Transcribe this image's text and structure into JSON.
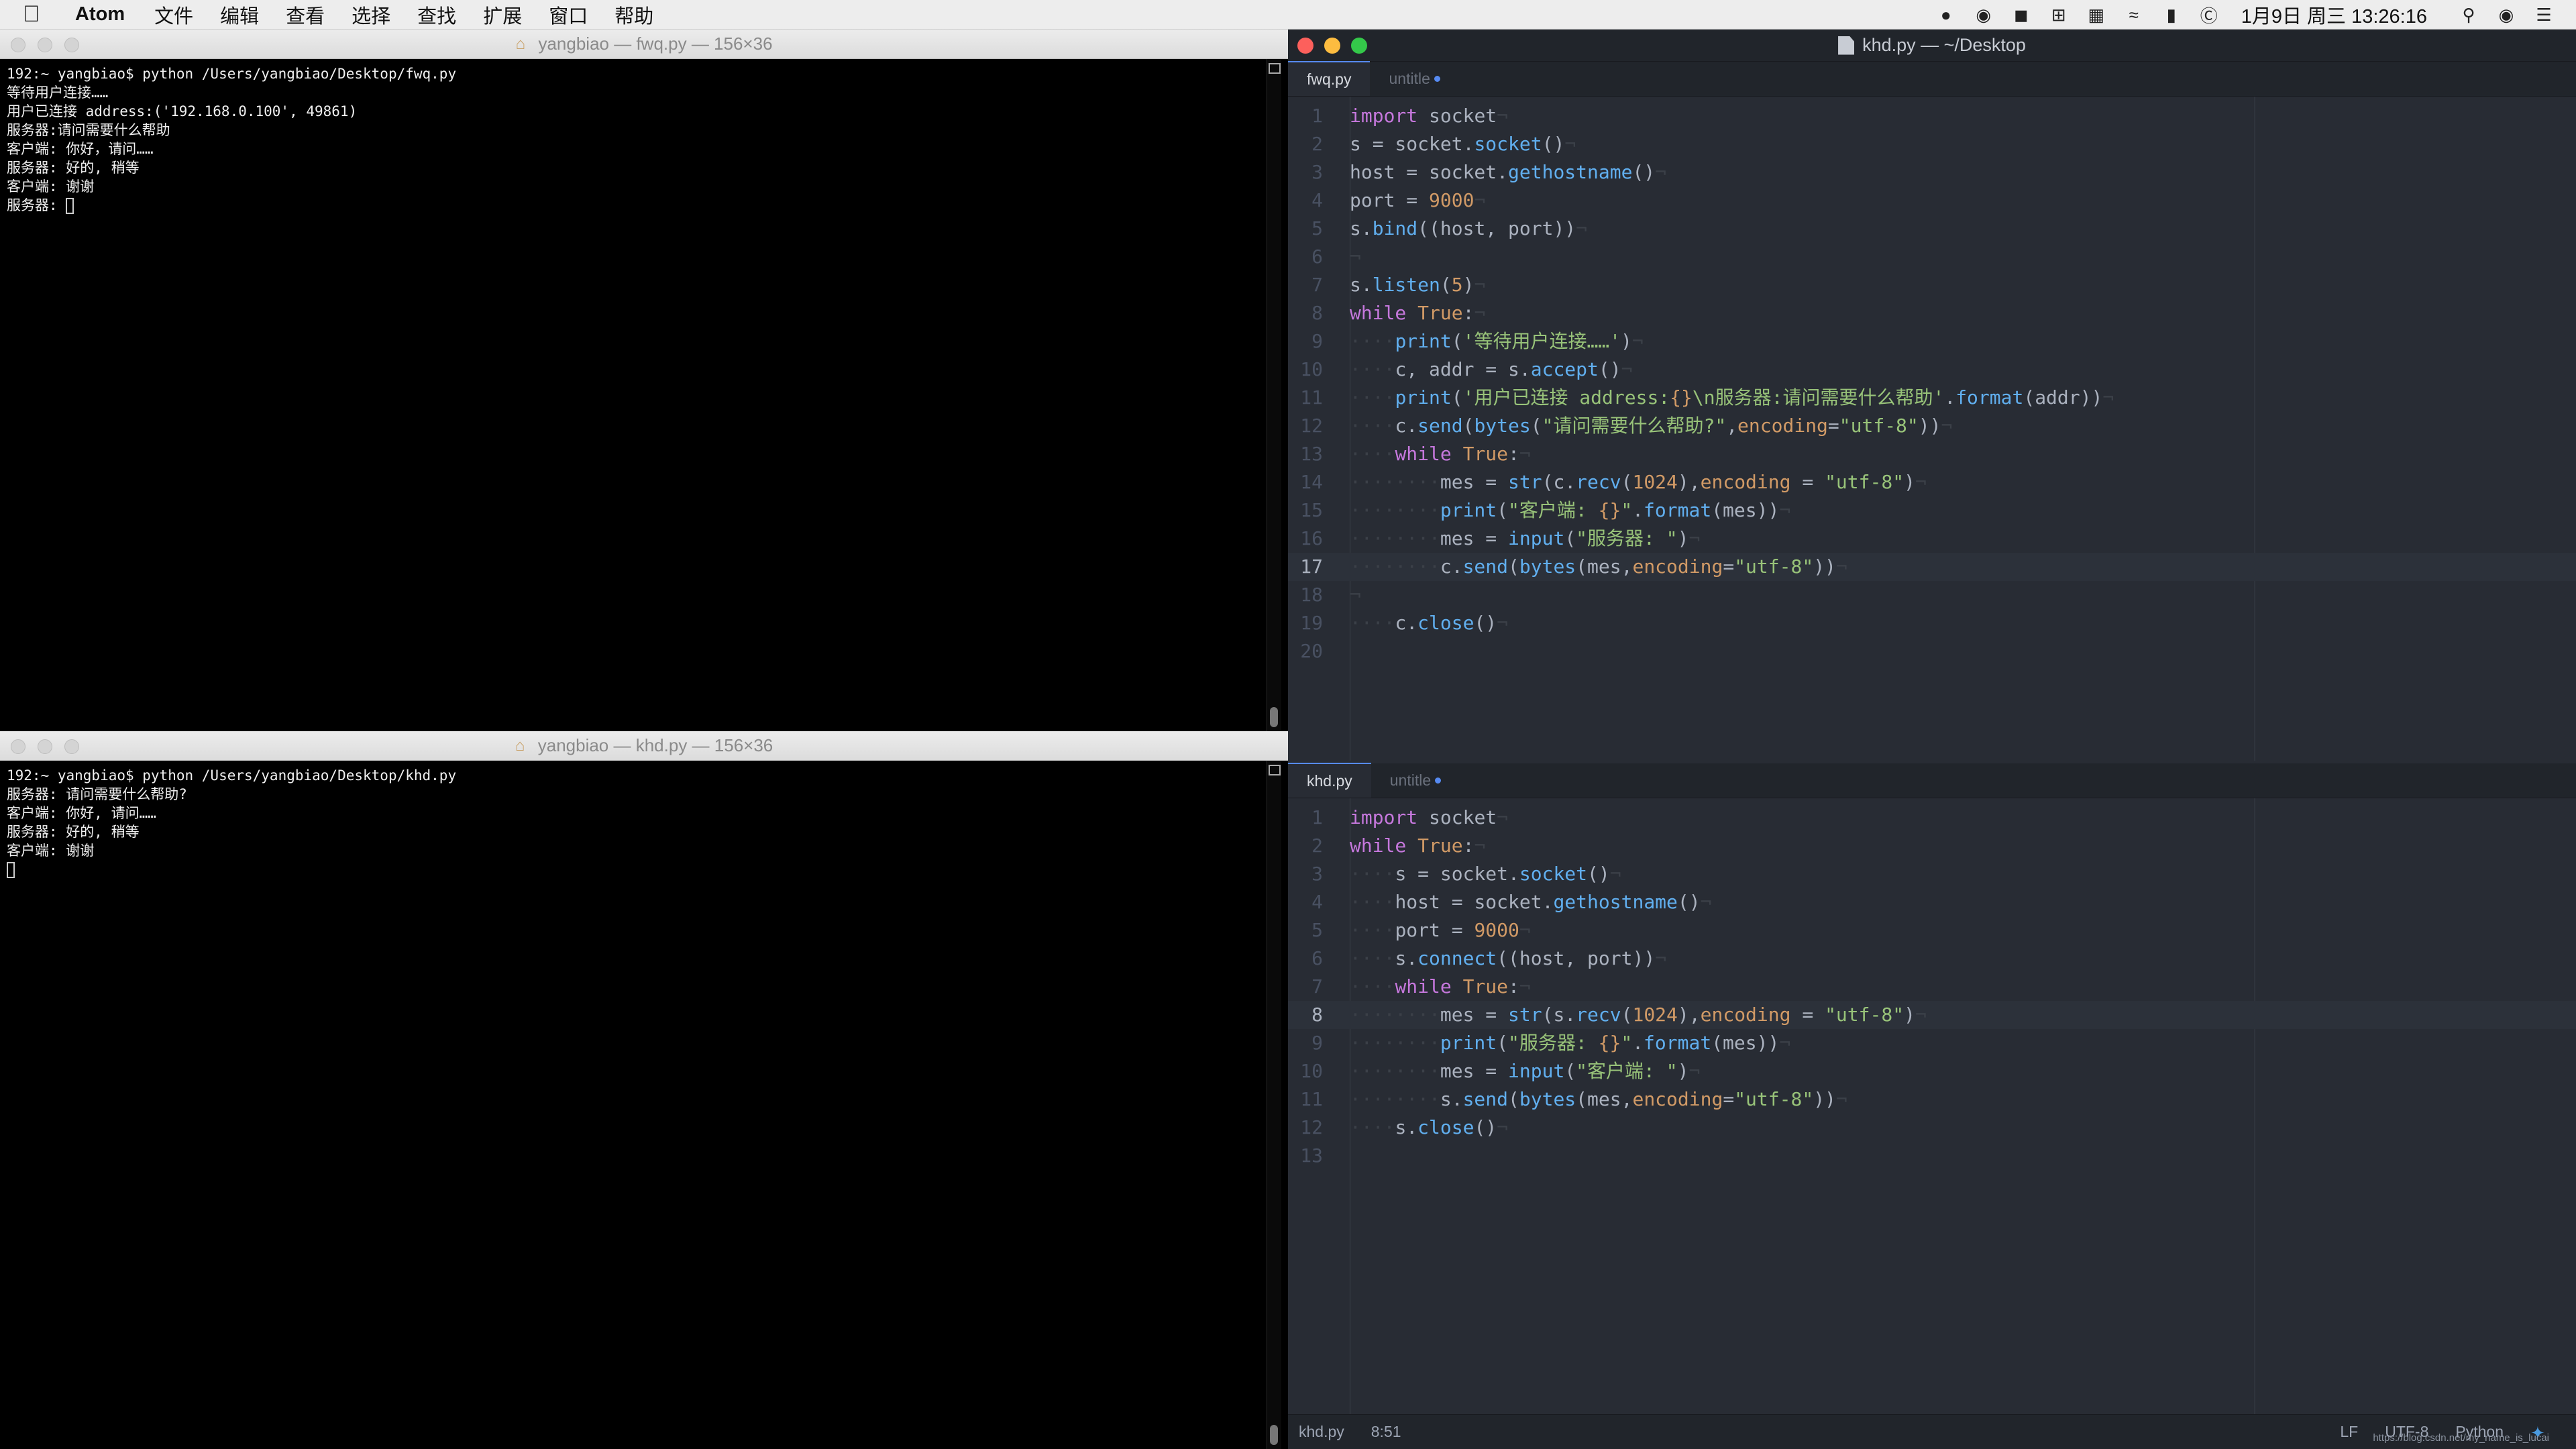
{
  "menubar": {
    "app_name": "Atom",
    "items": [
      "文件",
      "编辑",
      "查看",
      "选择",
      "查找",
      "扩展",
      "窗口",
      "帮助"
    ],
    "clock": "1月9日 周三 13:26:16"
  },
  "term_top": {
    "title": "yangbiao — fwq.py — 156×36",
    "lines": [
      "192:~ yangbiao$ python /Users/yangbiao/Desktop/fwq.py",
      "等待用户连接……",
      "用户已连接 address:('192.168.0.100', 49861)",
      "服务器:请问需要什么帮助",
      "客户端: 你好，请问……",
      "服务器: 好的, 稍等",
      "客户端: 谢谢",
      "服务器: "
    ]
  },
  "term_bottom": {
    "title": "yangbiao — khd.py — 156×36",
    "lines": [
      "192:~ yangbiao$ python /Users/yangbiao/Desktop/khd.py",
      "服务器: 请问需要什么帮助?",
      "客户端: 你好, 请问……",
      "服务器: 好的, 稍等",
      "客户端: 谢谢",
      ""
    ]
  },
  "atom": {
    "window_title": "khd.py — ~/Desktop",
    "top_pane": {
      "tab_active": "fwq.py",
      "tab_inactive": "untitle"
    },
    "bottom_pane": {
      "tab_active": "khd.py",
      "tab_inactive": "untitle"
    },
    "status": {
      "file": "khd.py",
      "cursor": "8:51",
      "line_ending": "LF",
      "encoding": "UTF-8",
      "grammar": "Python",
      "watermark": "https://blog.csdn.net/my_name_is_lucai"
    }
  }
}
